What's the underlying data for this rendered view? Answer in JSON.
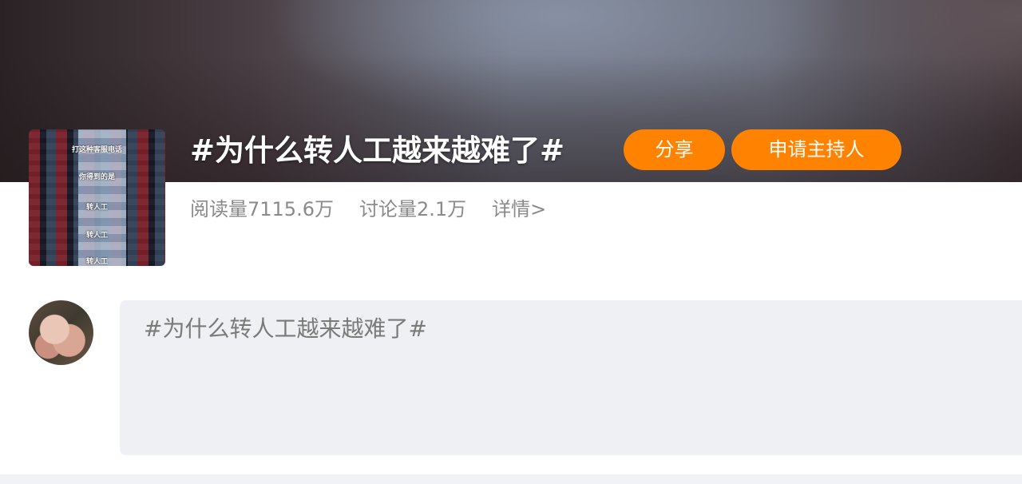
{
  "topic": {
    "title": "#为什么转人工越来越难了#",
    "buttons": {
      "share": "分享",
      "apply_host": "申请主持人"
    },
    "stats": {
      "reads": "阅读量7115.6万",
      "discussions": "讨论量2.1万",
      "detail_link": "详情>"
    },
    "cover": {
      "captions": [
        "打这种客服电话",
        "你得到的是",
        "转人工",
        "转人工",
        "转人工"
      ]
    },
    "accent_color": "#ff8200"
  },
  "composer": {
    "text": "#为什么转人工越来越难了#"
  }
}
